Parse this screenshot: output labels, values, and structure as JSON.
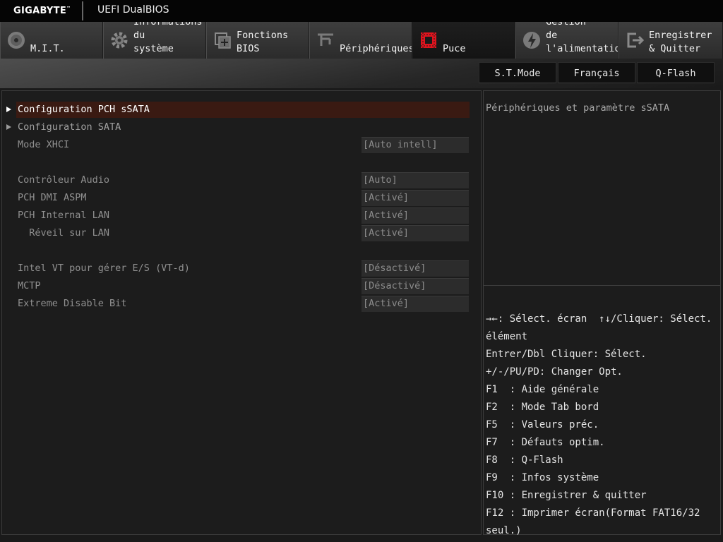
{
  "header": {
    "brand": "GIGABYTE",
    "brand_tm": "™",
    "product": "UEFI DualBIOS"
  },
  "tabs": [
    {
      "label": "M.I.T.",
      "icon": "mit-disc-icon",
      "active": false
    },
    {
      "label": "Informations\ndu\nsystème",
      "icon": "gear-icon",
      "active": false
    },
    {
      "label": "Fonctions\nBIOS",
      "icon": "bios-chip-icon",
      "active": false
    },
    {
      "label": "Périphériques",
      "icon": "peripherals-icon",
      "active": false
    },
    {
      "label": "Puce",
      "icon": "chipset-icon",
      "active": true
    },
    {
      "label": "Gestion\nde\nl'alimentatio",
      "icon": "power-icon",
      "active": false
    },
    {
      "label": "Enregistrer\n& Quitter",
      "icon": "exit-icon",
      "active": false
    }
  ],
  "quick_buttons": {
    "stmode": "S.T.Mode",
    "language": "Français",
    "qflash": "Q-Flash"
  },
  "settings": [
    {
      "label": "Configuration PCH sSATA",
      "type": "submenu",
      "selected": true
    },
    {
      "label": "Configuration SATA",
      "type": "submenu",
      "selected": false
    },
    {
      "label": "Mode XHCI",
      "type": "option",
      "value": "[Auto intell]"
    },
    {
      "label": "Contrôleur Audio",
      "type": "option",
      "value": "[Auto]"
    },
    {
      "label": "PCH DMI ASPM",
      "type": "option",
      "value": "[Activé]"
    },
    {
      "label": "PCH Internal LAN",
      "type": "option",
      "value": "[Activé]"
    },
    {
      "label": "  Réveil sur LAN",
      "type": "option",
      "value": "[Activé]"
    },
    {
      "label": "Intel VT pour gérer E/S (VT-d)",
      "type": "option",
      "value": "[Désactivé]"
    },
    {
      "label": "MCTP",
      "type": "option",
      "value": "[Désactivé]"
    },
    {
      "label": "Extreme Disable Bit",
      "type": "option",
      "value": "[Activé]"
    }
  ],
  "help": {
    "description": "Périphériques et paramètre sSATA",
    "keys": [
      "→←: Sélect. écran  ↑↓/Cliquer: Sélect.",
      "élément",
      "Entrer/Dbl Cliquer: Sélect.",
      "+/-/PU/PD: Changer Opt.",
      "F1  : Aide générale",
      "F2  : Mode Tab bord",
      "F5  : Valeurs préc.",
      "F7  : Défauts optim.",
      "F8  : Q-Flash",
      "F9  : Infos système",
      "F10 : Enregistrer & quitter",
      "F12 : Imprimer écran(Format FAT16/32",
      "seul.)"
    ]
  },
  "colors": {
    "background": "#1a1a1a",
    "accent_red": "#e0141e",
    "selected_row": "#3a1a12"
  }
}
